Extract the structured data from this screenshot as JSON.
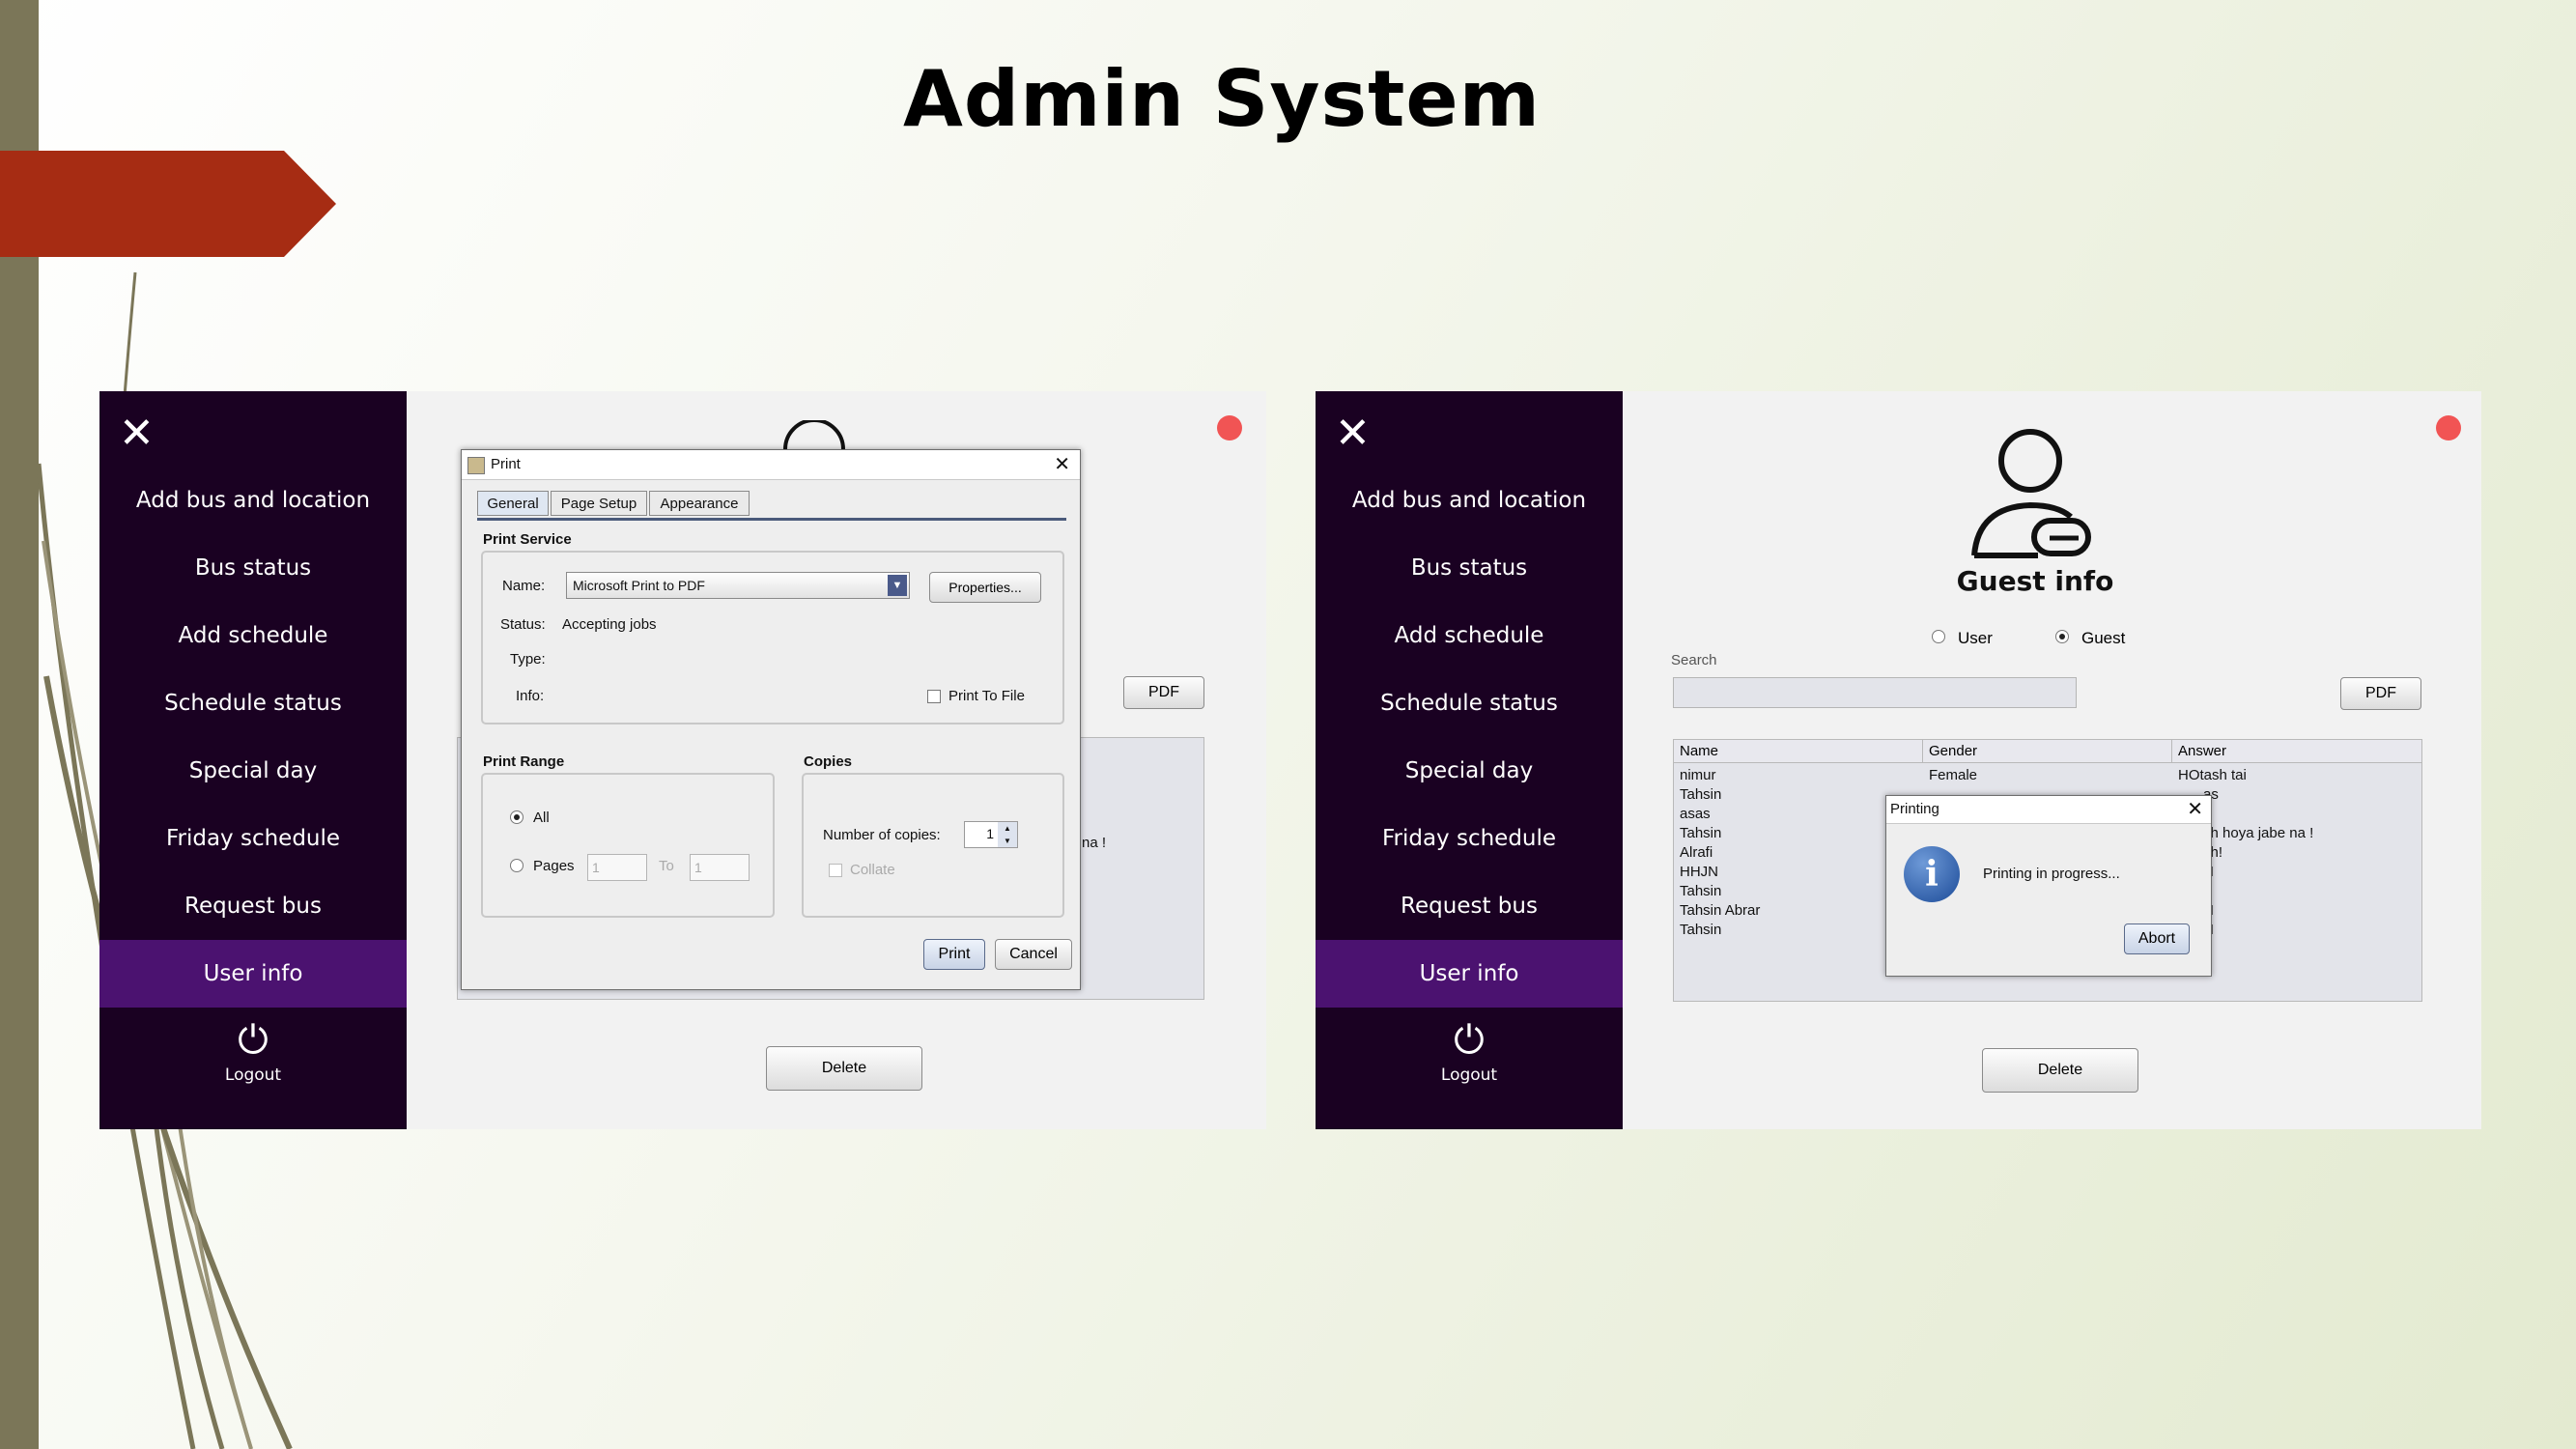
{
  "slide": {
    "title": "Admin System",
    "colors": {
      "accent_arrow": "#a62c13",
      "sidebar": "#1a0122",
      "sidebar_active": "#4b1270",
      "close_dot": "#f15454"
    }
  },
  "sidebar": {
    "items": [
      "Add bus and location",
      "Bus status",
      "Add schedule",
      "Schedule status",
      "Special day",
      "Friday schedule",
      "Request bus",
      "User info"
    ],
    "active": "User info",
    "logout_label": "Logout",
    "close_icon": "close-icon",
    "logout_icon": "power-icon"
  },
  "left_screen": {
    "pdf_label": "PDF",
    "delete_label": "Delete",
    "partial_text": "na !",
    "print_dialog": {
      "title": "Print",
      "tabs": [
        "General",
        "Page Setup",
        "Appearance"
      ],
      "print_service_label": "Print Service",
      "name_label": "Name:",
      "printer_name": "Microsoft Print to PDF",
      "properties_label": "Properties...",
      "status_label": "Status:",
      "status_value": "Accepting jobs",
      "type_label": "Type:",
      "info_label": "Info:",
      "print_to_file_label": "Print To File",
      "print_range_label": "Print Range",
      "all_label": "All",
      "pages_label": "Pages",
      "pages_from": "1",
      "to_label": "To",
      "pages_to": "1",
      "copies_label": "Copies",
      "number_of_copies_label": "Number of copies:",
      "copies_value": "1",
      "collate_label": "Collate",
      "print_button": "Print",
      "cancel_button": "Cancel"
    }
  },
  "right_screen": {
    "heading": "Guest info",
    "radio_user": "User",
    "radio_guest": "Guest",
    "selected": "Guest",
    "search_label": "Search",
    "pdf_label": "PDF",
    "delete_label": "Delete",
    "table": {
      "columns": [
        "Name",
        "Gender",
        "Answer"
      ],
      "names": [
        "nimur",
        "Tahsin",
        "asas",
        "Tahsin",
        "Alrafi",
        "HHJN",
        "Tahsin",
        "Tahsin Abrar",
        "Tahsin"
      ],
      "gender_visible": [
        "Female"
      ],
      "answer_visible": [
        "HOtash tai",
        "as",
        "s",
        "sh hoya jabe na !",
        "sh!",
        "N",
        "",
        "N",
        "N"
      ]
    },
    "printing_dialog": {
      "title": "Printing",
      "message": "Printing in progress...",
      "abort_label": "Abort",
      "icon": "info-icon"
    }
  }
}
